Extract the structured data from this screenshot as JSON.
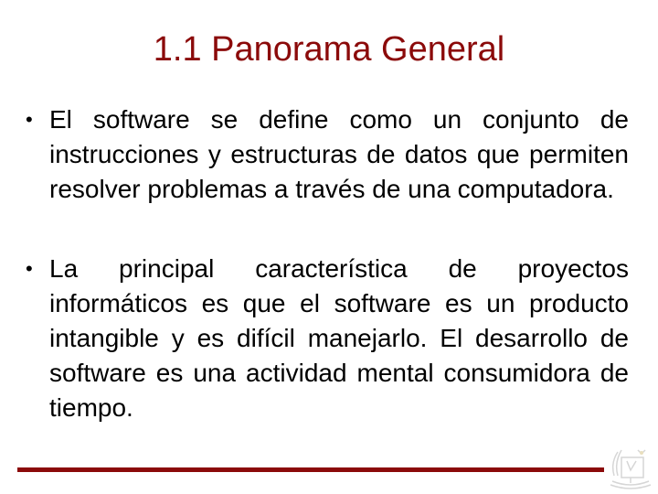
{
  "slide": {
    "title": "1.1 Panorama General",
    "bullets": [
      {
        "marker": "•",
        "text": "El software se define como un conjunto de instrucciones y estructuras de datos que permiten resolver problemas a través de una computadora."
      },
      {
        "marker": "•",
        "text": "La principal característica de proyectos informáticos es que el software es un producto intangible y es difícil manejarlo. El desarrollo de software es una actividad mental consumidora de tiempo."
      }
    ],
    "accent_color": "#8b0a0a",
    "logo_icon": "institution-crest-icon"
  }
}
